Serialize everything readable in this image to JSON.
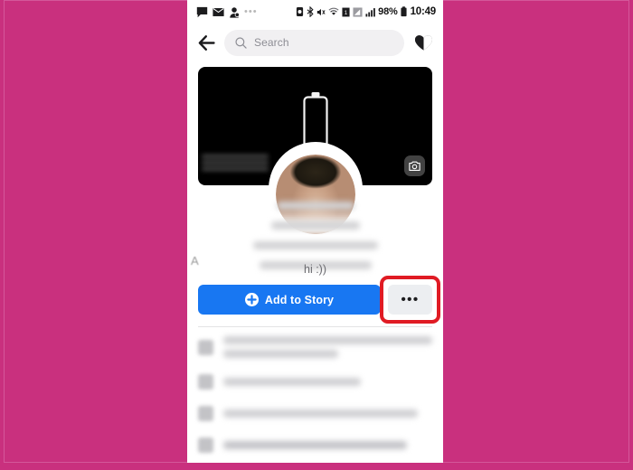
{
  "meta": {
    "background_color": "#c9307e",
    "accent_blue": "#1877f2",
    "highlight_color": "#e01b24"
  },
  "status_bar": {
    "left_icons": [
      "messenger-chat-icon",
      "email-icon",
      "contacts-icon"
    ],
    "overflow_dots": "•••",
    "right_icons": [
      "alarm-icon",
      "bluetooth-icon",
      "mute-icon",
      "wifi-icon",
      "sim-card-icon",
      "signal-bars-icon",
      "cellular-bars-icon"
    ],
    "battery_percent": "98%",
    "time": "10:49"
  },
  "header": {
    "back_icon": "back-arrow-icon",
    "search": {
      "icon": "search-icon",
      "placeholder": "Search",
      "value": ""
    },
    "heart_icon": "heart-icon"
  },
  "cover": {
    "camera_icon": "camera-icon",
    "cover_name_obscured": "",
    "art": "battery-outline-graphic"
  },
  "profile": {
    "avatar_name": "profile-picture",
    "name_obscured": "",
    "details_obscured": "",
    "bio": "hi :))",
    "verified_mark": "A"
  },
  "actions": {
    "add_to_story": {
      "label": "Add to Story",
      "icon": "plus-circle-icon"
    },
    "more": {
      "label": "•••",
      "icon": "more-options-icon",
      "highlighted": true
    }
  },
  "details_list": {
    "rows": [
      {
        "icon": "work-icon",
        "text_obscured": ""
      },
      {
        "icon": "education-icon",
        "text_obscured": ""
      },
      {
        "icon": "home-icon",
        "text_obscured": ""
      },
      {
        "icon": "followers-icon",
        "text_obscured": ""
      }
    ]
  }
}
